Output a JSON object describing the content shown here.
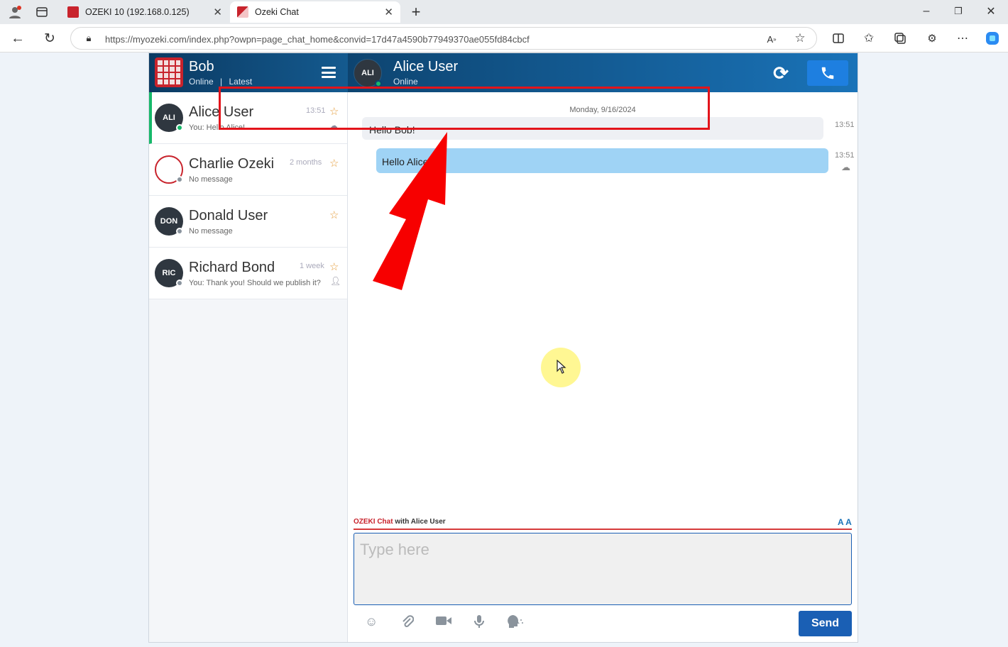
{
  "browser": {
    "tabs": [
      {
        "title": "OZEKI 10 (192.168.0.125)",
        "active": false
      },
      {
        "title": "Ozeki Chat",
        "active": true
      }
    ],
    "url": "https://myozeki.com/index.php?owpn=page_chat_home&convid=17d47a4590b77949370ae055fd84cbcf"
  },
  "sidebar": {
    "user_name": "Bob",
    "status": "Online",
    "separator": "|",
    "filter": "Latest",
    "contacts": [
      {
        "name": "Alice User",
        "avatar": "ALI",
        "last_message": "You: Hello Alice!",
        "time": "13:51",
        "online": true
      },
      {
        "name": "Charlie Ozeki",
        "avatar": "",
        "last_message": "No message",
        "time": "2 months",
        "online": false
      },
      {
        "name": "Donald User",
        "avatar": "DON",
        "last_message": "No message",
        "time": "",
        "online": false
      },
      {
        "name": "Richard Bond",
        "avatar": "RIC",
        "last_message": "You: Thank you! Should we publish it?",
        "time": "1 week",
        "online": false
      }
    ]
  },
  "chat": {
    "partner_name": "Alice User",
    "partner_avatar": "ALI",
    "partner_status": "Online",
    "date_header": "Monday, 9/16/2024",
    "messages": [
      {
        "text": "Hello Bob!",
        "time": "13:51",
        "direction": "in"
      },
      {
        "text": "Hello Alice!",
        "time": "13:51",
        "direction": "out"
      }
    ]
  },
  "composer": {
    "brand": "OZEKI Chat",
    "with_label": "with Alice User",
    "font_size_label": "A A",
    "placeholder": "Type here",
    "send_label": "Send"
  },
  "colors": {
    "accent": "#1a5fb4",
    "highlight_box": "#e3141b",
    "online": "#16b86a",
    "outgoing_bubble": "#9fd3f5"
  }
}
